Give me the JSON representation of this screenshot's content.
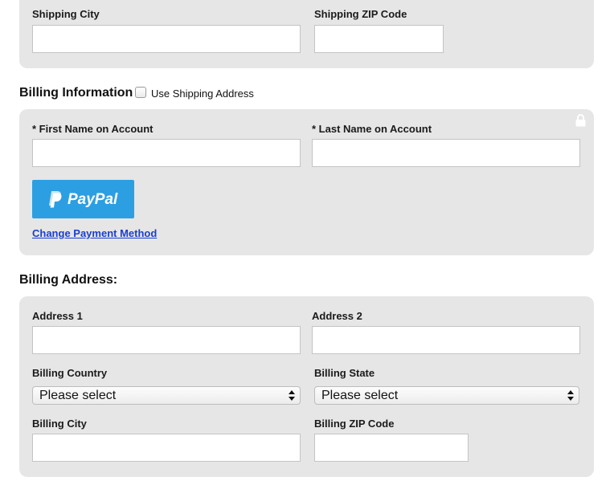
{
  "shipping": {
    "city_label": "Shipping City",
    "zip_label": "Shipping ZIP Code"
  },
  "billing_info": {
    "title": "Billing Information",
    "use_shipping_label": "Use Shipping Address",
    "use_shipping_checked": false,
    "first_name_label": "* First Name on Account",
    "last_name_label": "* Last Name on Account",
    "paypal_label": "PayPal",
    "change_payment_label": "Change Payment Method"
  },
  "billing_address": {
    "title": "Billing Address:",
    "address1_label": "Address 1",
    "address2_label": "Address 2",
    "country_label": "Billing Country",
    "country_value": "Please select",
    "state_label": "Billing State",
    "state_value": "Please select",
    "city_label": "Billing City",
    "zip_label": "Billing ZIP Code"
  },
  "icons": {
    "lock": "lock-icon",
    "paypal": "paypal-p-icon",
    "select_arrows": "select-arrows-icon"
  },
  "colors": {
    "panel_bg": "#e6e6e6",
    "paypal_blue": "#2c9fe3",
    "link_blue": "#1a3fd1"
  }
}
